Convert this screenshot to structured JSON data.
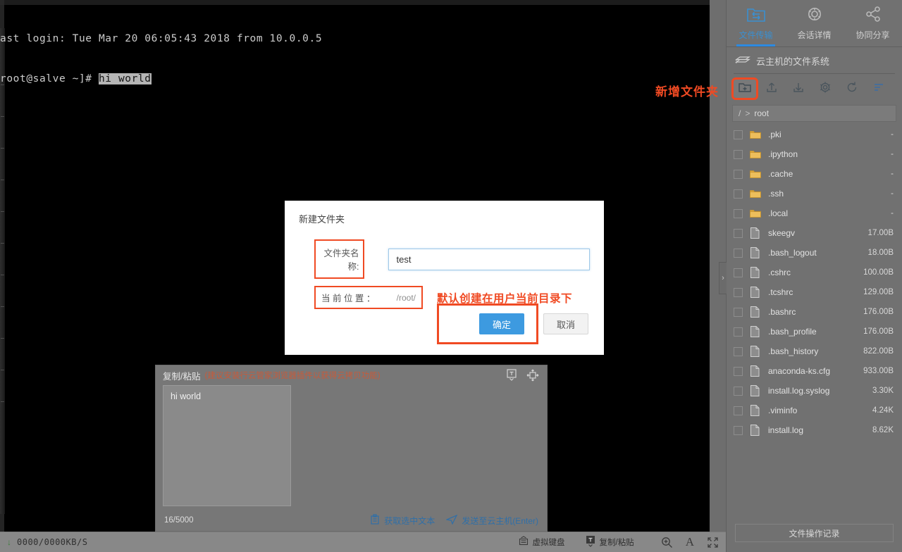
{
  "terminal": {
    "line1": "ast login: Tue Mar 20 06:05:43 2018 from 10.0.0.5",
    "line2_prompt": "root@salve ~]# ",
    "line2_selected": "hi world"
  },
  "right_panel": {
    "tabs": [
      {
        "label": "文件传输",
        "icon": "file-transfer-icon",
        "active": true
      },
      {
        "label": "会话详情",
        "icon": "gear-icon",
        "active": false
      },
      {
        "label": "协同分享",
        "icon": "share-icon",
        "active": false
      }
    ],
    "fs_title": "云主机的文件系统",
    "fs_title_icon": "server-stack-icon",
    "toolbar": [
      {
        "name": "new-folder-icon",
        "highlighted": true
      },
      {
        "name": "upload-icon",
        "highlighted": false
      },
      {
        "name": "download-icon",
        "highlighted": false
      },
      {
        "name": "settings-gear-icon",
        "highlighted": false
      },
      {
        "name": "refresh-icon",
        "highlighted": false
      },
      {
        "name": "sort-icon",
        "highlighted": false
      }
    ],
    "breadcrumb": {
      "root": "/",
      "separator": ">",
      "current": "root"
    },
    "files": [
      {
        "name": ".pki",
        "size": "-",
        "type": "folder"
      },
      {
        "name": ".ipython",
        "size": "-",
        "type": "folder"
      },
      {
        "name": ".cache",
        "size": "-",
        "type": "folder"
      },
      {
        "name": ".ssh",
        "size": "-",
        "type": "folder"
      },
      {
        "name": ".local",
        "size": "-",
        "type": "folder"
      },
      {
        "name": "skeegv",
        "size": "17.00B",
        "type": "file"
      },
      {
        "name": ".bash_logout",
        "size": "18.00B",
        "type": "file"
      },
      {
        "name": ".cshrc",
        "size": "100.00B",
        "type": "file"
      },
      {
        "name": ".tcshrc",
        "size": "129.00B",
        "type": "file"
      },
      {
        "name": ".bashrc",
        "size": "176.00B",
        "type": "file"
      },
      {
        "name": ".bash_profile",
        "size": "176.00B",
        "type": "file"
      },
      {
        "name": ".bash_history",
        "size": "822.00B",
        "type": "file"
      },
      {
        "name": "anaconda-ks.cfg",
        "size": "933.00B",
        "type": "file"
      },
      {
        "name": "install.log.syslog",
        "size": "3.30K",
        "type": "file"
      },
      {
        "name": ".viminfo",
        "size": "4.24K",
        "type": "file"
      },
      {
        "name": "install.log",
        "size": "8.62K",
        "type": "file"
      }
    ],
    "oplog_label": "文件操作记录",
    "collapse_chevron": "›"
  },
  "annotations": {
    "new_folder": "新增文件夹",
    "default_location": "默认创建在用户当前目录下",
    "color": "#f04a23"
  },
  "dialog": {
    "title": "新建文件夹",
    "name_label": "文件夹名称:",
    "name_value": "test",
    "name_placeholder": "",
    "location_label": "当 前 位 置 ：",
    "location_value": "/root/",
    "ok_label": "确定",
    "cancel_label": "取消",
    "ok_color": "#3d9ae0"
  },
  "copy_paste": {
    "title": "复制/粘贴",
    "hint": "(建议安装行云管家浏览器插件以获得云拷贝功能)",
    "text_value": "hi world",
    "char_count": "16/5000",
    "get_selected_label": "获取选中文本",
    "send_label": "发送至云主机(Enter)",
    "icons": [
      {
        "name": "text-toggle-icon"
      },
      {
        "name": "move-handle-icon"
      }
    ]
  },
  "statusbar": {
    "speed": "0000/0000KB/S",
    "virtual_keyboard_label": "虚拟键盘",
    "copy_paste_label": "复制/粘贴",
    "tools": [
      {
        "name": "zoom-icon"
      },
      {
        "name": "font-size-icon",
        "glyph": "A"
      },
      {
        "name": "fullscreen-icon"
      }
    ]
  }
}
